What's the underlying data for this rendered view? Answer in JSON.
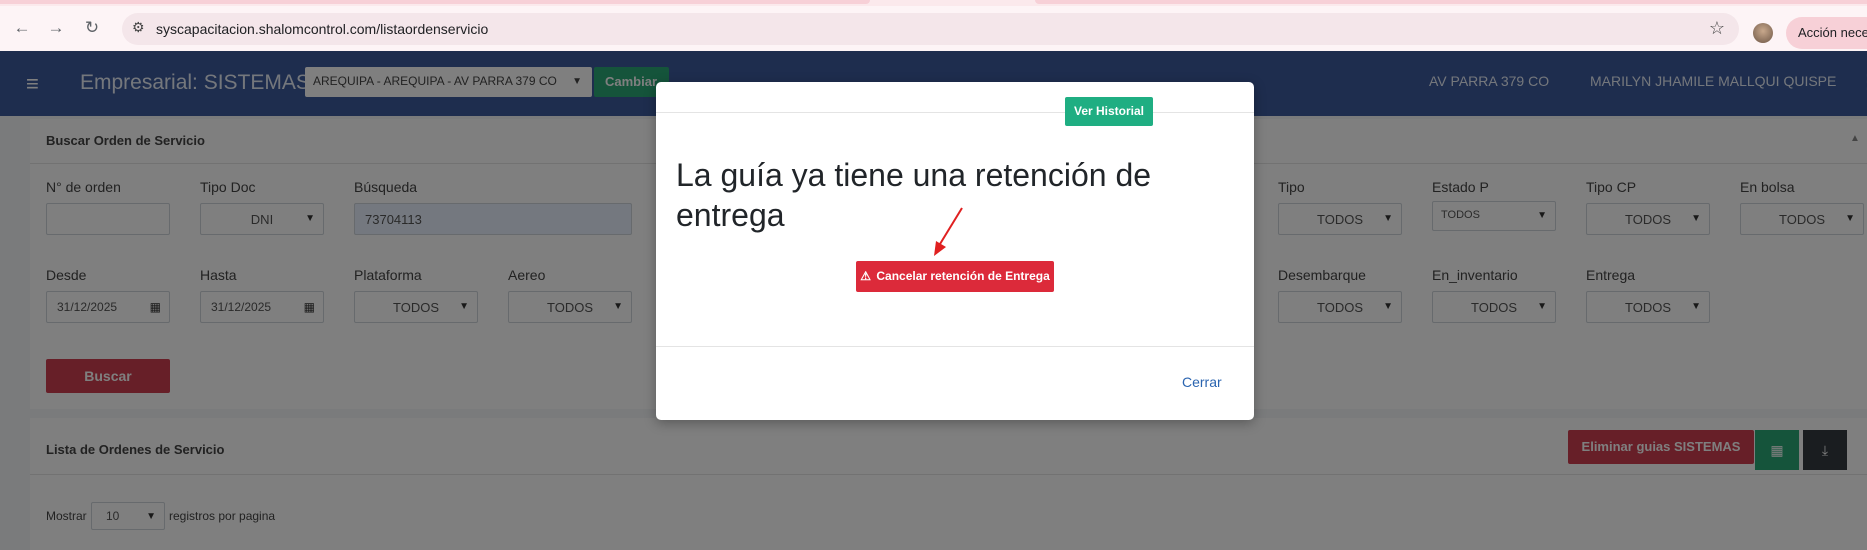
{
  "browser": {
    "url": "syscapacitacion.shalomcontrol.com/listaordenservicio",
    "action_label": "Acción necesaria"
  },
  "app": {
    "brand": "Empresarial: SISTEMAS",
    "branch": "AREQUIPA - AREQUIPA - AV PARRA 379 CO",
    "change_label": "Cambiar",
    "agency": "AV PARRA 379 CO",
    "user": "MARILYN JHAMILE MALLQUI QUISPE"
  },
  "search": {
    "title": "Buscar Orden de Servicio",
    "order_label": "N° de orden",
    "order_value": "",
    "doc_type_label": "Tipo Doc",
    "doc_type_value": "DNI",
    "query_label": "Búsqueda",
    "query_value": "73704113",
    "tipo_label": "Tipo",
    "tipo_value": "TODOS",
    "estado_label": "Estado P",
    "estado_value": "TODOS",
    "tipocp_label": "Tipo CP",
    "tipocp_value": "TODOS",
    "bolsa_label": "En bolsa",
    "bolsa_value": "TODOS",
    "desde_label": "Desde",
    "desde_value": "31/12/2025",
    "hasta_label": "Hasta",
    "hasta_value": "31/12/2025",
    "plataforma_label": "Plataforma",
    "plataforma_value": "TODOS",
    "aereo_label": "Aereo",
    "aereo_value": "TODOS",
    "desembarque_label": "Desembarque",
    "desembarque_value": "TODOS",
    "inventario_label": "En_inventario",
    "inventario_value": "TODOS",
    "entrega_label": "Entrega",
    "entrega_value": "TODOS",
    "search_button": "Buscar"
  },
  "list": {
    "title": "Lista de Ordenes de Servicio",
    "delete_button": "Eliminar guias SISTEMAS",
    "show_label": "Mostrar",
    "page_size": "10",
    "per_page_label": "registros por pagina"
  },
  "modal": {
    "history_button": "Ver Historial",
    "message": "La guía ya tiene una retención de entrega",
    "cancel_button": "Cancelar retención de Entrega",
    "close_button": "Cerrar"
  }
}
